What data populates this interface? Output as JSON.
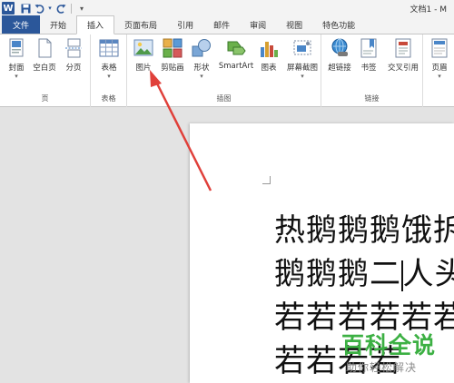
{
  "titlebar": {
    "app_letter": "W",
    "doc_title": "文档1 - M"
  },
  "tabs": [
    "文件",
    "开始",
    "插入",
    "页面布局",
    "引用",
    "邮件",
    "审阅",
    "视图",
    "特色功能"
  ],
  "ribbon": {
    "groups": {
      "pages": "页",
      "table": "表格",
      "illustrations": "插图",
      "links": "链接"
    },
    "buttons": {
      "cover": "封面",
      "blank": "空白页",
      "break": "分页",
      "table": "表格",
      "picture": "图片",
      "clipart": "剪贴画",
      "shapes": "形状",
      "smartart": "SmartArt",
      "chart": "图表",
      "screenshot": "屏幕截图",
      "hyperlink": "超链接",
      "bookmark": "书签",
      "crossref": "交叉引用",
      "header": "页眉"
    },
    "dropdown_glyph": "▾"
  },
  "document": {
    "lines": [
      "热鹅鹅鹅饿拆",
      "鹅鹅鹅二",
      "若若若若若若",
      "若若若若"
    ],
    "line2_after_cursor": "人头"
  },
  "watermark": {
    "main": "百科全说",
    "sub": "助你轻松解决"
  },
  "colors": {
    "accent": "#2b579a",
    "arrow": "#e0403a",
    "watermark": "#3cb043"
  },
  "icons": [
    "word-icon",
    "save-icon",
    "undo-icon",
    "redo-icon",
    "customize-icon",
    "cover-icon",
    "blank-page-icon",
    "page-break-icon",
    "table-icon",
    "picture-icon",
    "clipart-icon",
    "shapes-icon",
    "smartart-icon",
    "chart-icon",
    "screenshot-icon",
    "hyperlink-icon",
    "bookmark-icon",
    "crossref-icon",
    "header-icon"
  ]
}
